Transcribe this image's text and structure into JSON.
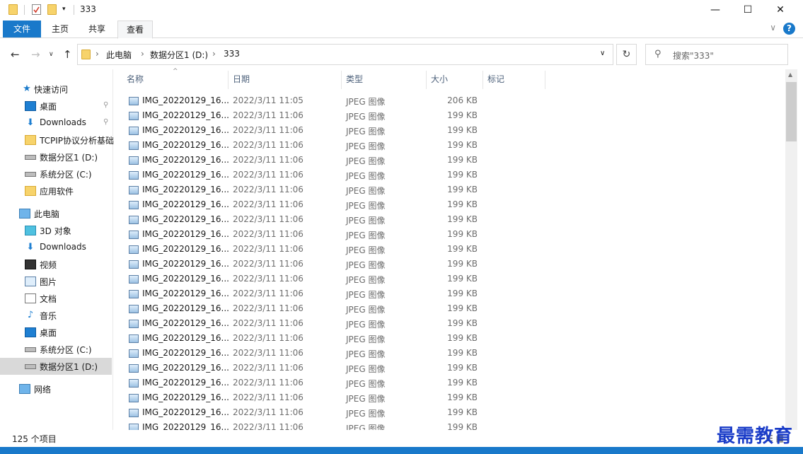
{
  "window": {
    "title": "333",
    "minimize": "—",
    "maximize": "☐",
    "close": "✕"
  },
  "ribbon": {
    "tabs": [
      "文件",
      "主页",
      "共享",
      "查看"
    ],
    "help": "?",
    "collapse": "∨"
  },
  "address": {
    "crumbs": [
      "此电脑",
      "数据分区1 (D:)",
      "333"
    ],
    "search_placeholder": "搜索\"333\""
  },
  "sidebar": {
    "items": [
      {
        "label": "快速访问",
        "icon": "star-icon"
      },
      {
        "label": "桌面",
        "icon": "desktop-icon",
        "pinned": true
      },
      {
        "label": "Downloads",
        "icon": "download-icon",
        "pinned": true
      },
      {
        "label": "TCPIP协议分析基础",
        "icon": "folder-icon"
      },
      {
        "label": "数据分区1 (D:)",
        "icon": "drive-icon"
      },
      {
        "label": "系统分区 (C:)",
        "icon": "system-drive-icon"
      },
      {
        "label": "应用软件",
        "icon": "folder-icon"
      },
      {
        "label": "此电脑",
        "icon": "computer-icon"
      },
      {
        "label": "3D 对象",
        "icon": "3d-objects-icon"
      },
      {
        "label": "Downloads",
        "icon": "download-icon"
      },
      {
        "label": "视频",
        "icon": "video-icon"
      },
      {
        "label": "图片",
        "icon": "pictures-icon"
      },
      {
        "label": "文档",
        "icon": "documents-icon"
      },
      {
        "label": "音乐",
        "icon": "music-icon"
      },
      {
        "label": "桌面",
        "icon": "desktop-icon"
      },
      {
        "label": "系统分区 (C:)",
        "icon": "system-drive-icon"
      },
      {
        "label": "数据分区1 (D:)",
        "icon": "drive-icon",
        "selected": true
      },
      {
        "label": "网络",
        "icon": "network-icon"
      }
    ]
  },
  "columns": [
    "名称",
    "日期",
    "类型",
    "大小",
    "标记"
  ],
  "files": [
    {
      "name": "IMG_20220129_16...",
      "date": "2022/3/11 11:05",
      "type": "JPEG 图像",
      "size": "206 KB"
    },
    {
      "name": "IMG_20220129_16...",
      "date": "2022/3/11 11:06",
      "type": "JPEG 图像",
      "size": "199 KB"
    },
    {
      "name": "IMG_20220129_16...",
      "date": "2022/3/11 11:06",
      "type": "JPEG 图像",
      "size": "199 KB"
    },
    {
      "name": "IMG_20220129_16...",
      "date": "2022/3/11 11:06",
      "type": "JPEG 图像",
      "size": "199 KB"
    },
    {
      "name": "IMG_20220129_16...",
      "date": "2022/3/11 11:06",
      "type": "JPEG 图像",
      "size": "199 KB"
    },
    {
      "name": "IMG_20220129_16...",
      "date": "2022/3/11 11:06",
      "type": "JPEG 图像",
      "size": "199 KB"
    },
    {
      "name": "IMG_20220129_16...",
      "date": "2022/3/11 11:06",
      "type": "JPEG 图像",
      "size": "199 KB"
    },
    {
      "name": "IMG_20220129_16...",
      "date": "2022/3/11 11:06",
      "type": "JPEG 图像",
      "size": "199 KB"
    },
    {
      "name": "IMG_20220129_16...",
      "date": "2022/3/11 11:06",
      "type": "JPEG 图像",
      "size": "199 KB"
    },
    {
      "name": "IMG_20220129_16...",
      "date": "2022/3/11 11:06",
      "type": "JPEG 图像",
      "size": "199 KB"
    },
    {
      "name": "IMG_20220129_16...",
      "date": "2022/3/11 11:06",
      "type": "JPEG 图像",
      "size": "199 KB"
    },
    {
      "name": "IMG_20220129_16...",
      "date": "2022/3/11 11:06",
      "type": "JPEG 图像",
      "size": "199 KB"
    },
    {
      "name": "IMG_20220129_16...",
      "date": "2022/3/11 11:06",
      "type": "JPEG 图像",
      "size": "199 KB"
    },
    {
      "name": "IMG_20220129_16...",
      "date": "2022/3/11 11:06",
      "type": "JPEG 图像",
      "size": "199 KB"
    },
    {
      "name": "IMG_20220129_16...",
      "date": "2022/3/11 11:06",
      "type": "JPEG 图像",
      "size": "199 KB"
    },
    {
      "name": "IMG_20220129_16...",
      "date": "2022/3/11 11:06",
      "type": "JPEG 图像",
      "size": "199 KB"
    },
    {
      "name": "IMG_20220129_16...",
      "date": "2022/3/11 11:06",
      "type": "JPEG 图像",
      "size": "199 KB"
    },
    {
      "name": "IMG_20220129_16...",
      "date": "2022/3/11 11:06",
      "type": "JPEG 图像",
      "size": "199 KB"
    },
    {
      "name": "IMG_20220129_16...",
      "date": "2022/3/11 11:06",
      "type": "JPEG 图像",
      "size": "199 KB"
    },
    {
      "name": "IMG_20220129_16...",
      "date": "2022/3/11 11:06",
      "type": "JPEG 图像",
      "size": "199 KB"
    },
    {
      "name": "IMG_20220129_16...",
      "date": "2022/3/11 11:06",
      "type": "JPEG 图像",
      "size": "199 KB"
    },
    {
      "name": "IMG_20220129_16...",
      "date": "2022/3/11 11:06",
      "type": "JPEG 图像",
      "size": "199 KB"
    },
    {
      "name": "IMG_20220129_16...",
      "date": "2022/3/11 11:06",
      "type": "JPEG 图像",
      "size": "199 KB"
    }
  ],
  "status": {
    "count": "125 个项目"
  },
  "watermark": "最需教育",
  "colors": {
    "accent": "#1979ca",
    "selected_nav": "#d9d9d9",
    "watermark": "#1a3cc8"
  }
}
